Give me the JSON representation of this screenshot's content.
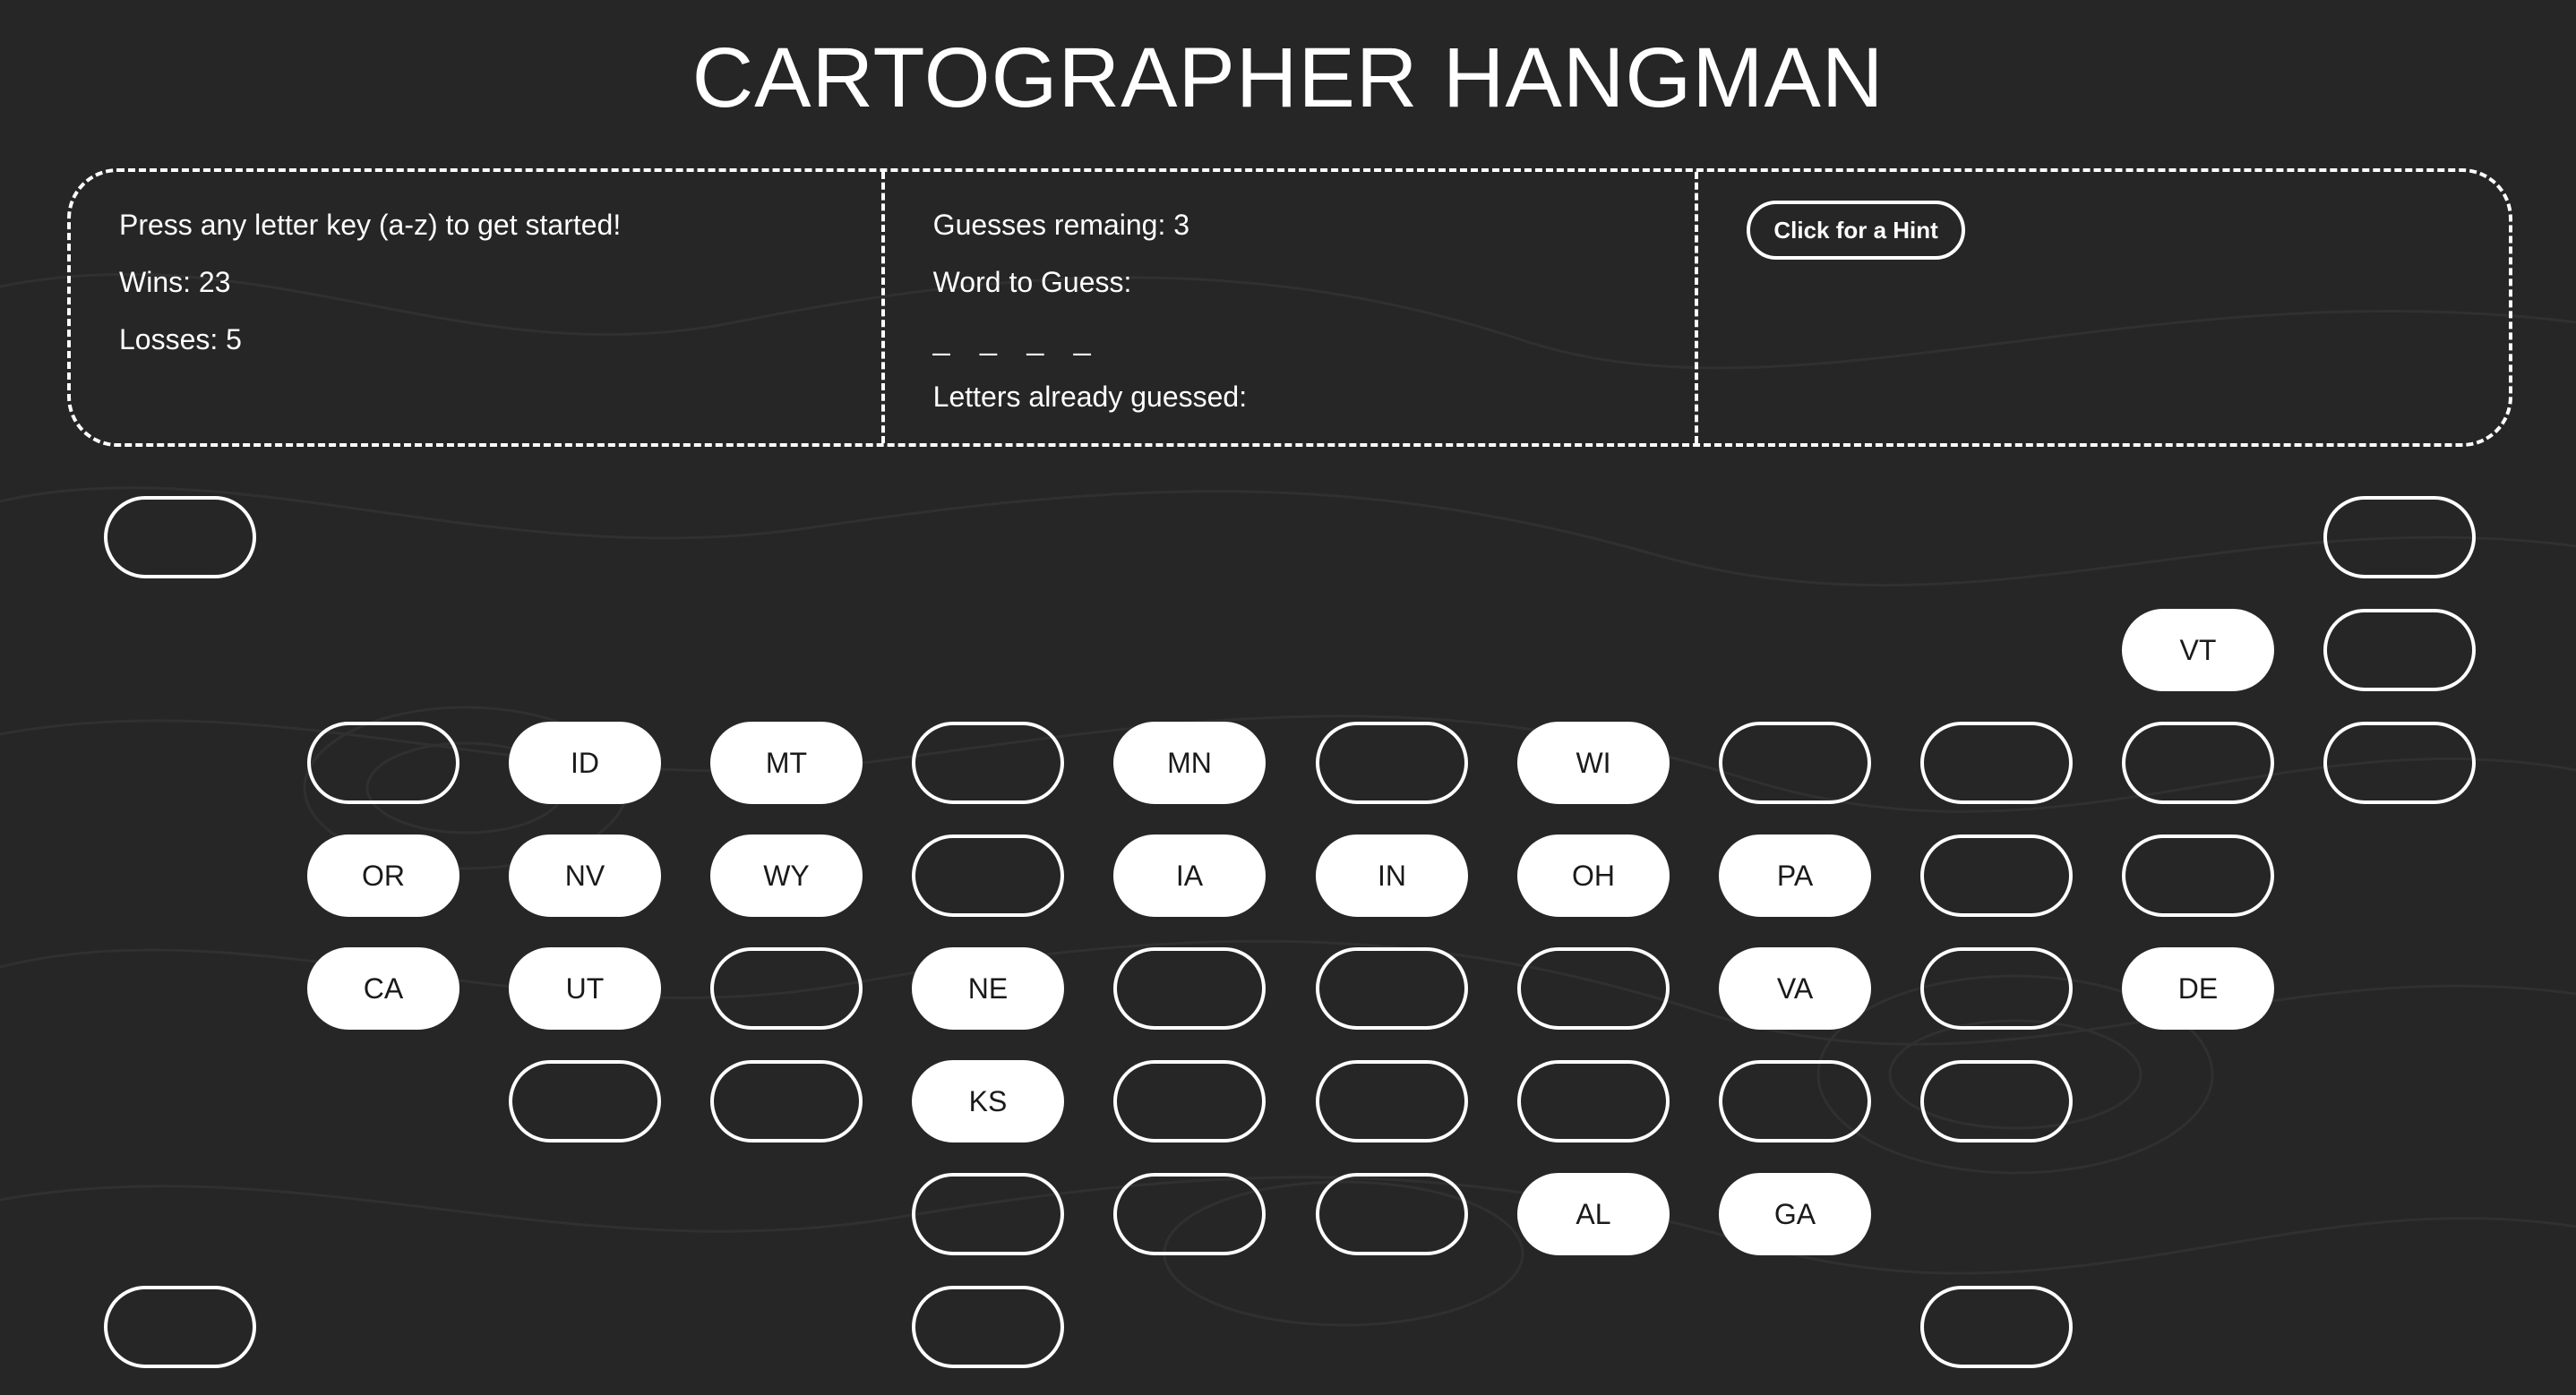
{
  "title": "CARTOGRAPHER HANGMAN",
  "status": {
    "prompt": "Press any letter key (a-z) to get started!",
    "wins": "Wins: 23",
    "losses": "Losses: 5"
  },
  "game": {
    "guesses_remaining": "Guesses remaing: 3",
    "word_label": "Word to Guess:",
    "word_blanks": "_ _ _ _",
    "letters_guessed_label": "Letters already guessed:"
  },
  "hint": {
    "button_label": "Click for a Hint"
  },
  "map": {
    "tile_fill": "#ffffff",
    "tile_outline": "#ffffff",
    "filled_states": [
      "VT",
      "ID",
      "MT",
      "MN",
      "WI",
      "OR",
      "NV",
      "WY",
      "IA",
      "IN",
      "OH",
      "PA",
      "CA",
      "UT",
      "NE",
      "VA",
      "DE",
      "KS",
      "AL",
      "GA"
    ]
  }
}
